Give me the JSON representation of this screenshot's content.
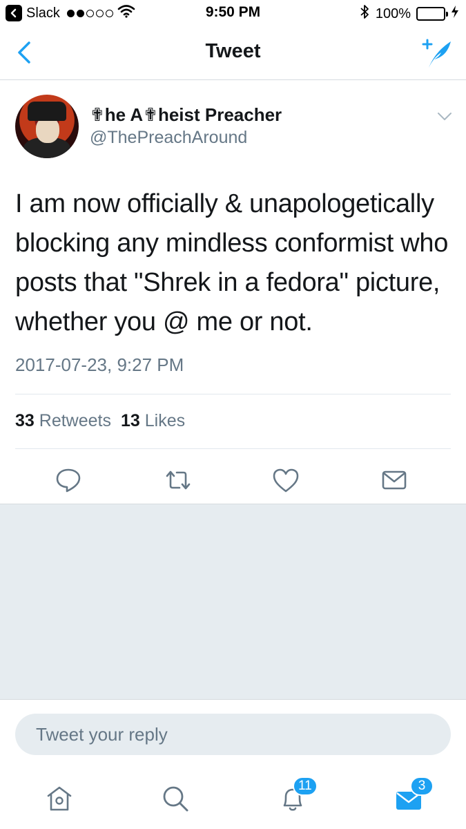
{
  "status_bar": {
    "back_app": "Slack",
    "time": "9:50 PM",
    "battery": "100%"
  },
  "nav": {
    "title": "Tweet"
  },
  "tweet": {
    "author_name": "✟he A✟heist Preacher",
    "author_handle": "@ThePreachAround",
    "text": "I am now officially & unapologetically blocking any mindless conformist who posts that \"Shrek in a fedora\" picture, whether you @ me or not.",
    "timestamp": "2017-07-23, 9:27 PM",
    "retweets_count": "33",
    "retweets_label": "Retweets",
    "likes_count": "13",
    "likes_label": "Likes"
  },
  "reply": {
    "placeholder": "Tweet your reply"
  },
  "tab_bar": {
    "notifications_badge": "11",
    "messages_badge": "3"
  },
  "icons": {
    "back": "chevron-left-icon",
    "compose": "compose-tweet-icon",
    "caret": "chevron-down-icon",
    "reply": "reply-icon",
    "retweet": "retweet-icon",
    "like": "heart-icon",
    "dm": "envelope-icon",
    "home": "home-icon",
    "search": "search-icon",
    "notifications": "bell-icon",
    "messages": "mail-icon"
  },
  "colors": {
    "accent": "#1da1f2",
    "text_primary": "#14171a",
    "text_secondary": "#657786",
    "background_gray": "#e6ecf0",
    "battery": "#4cd964"
  }
}
